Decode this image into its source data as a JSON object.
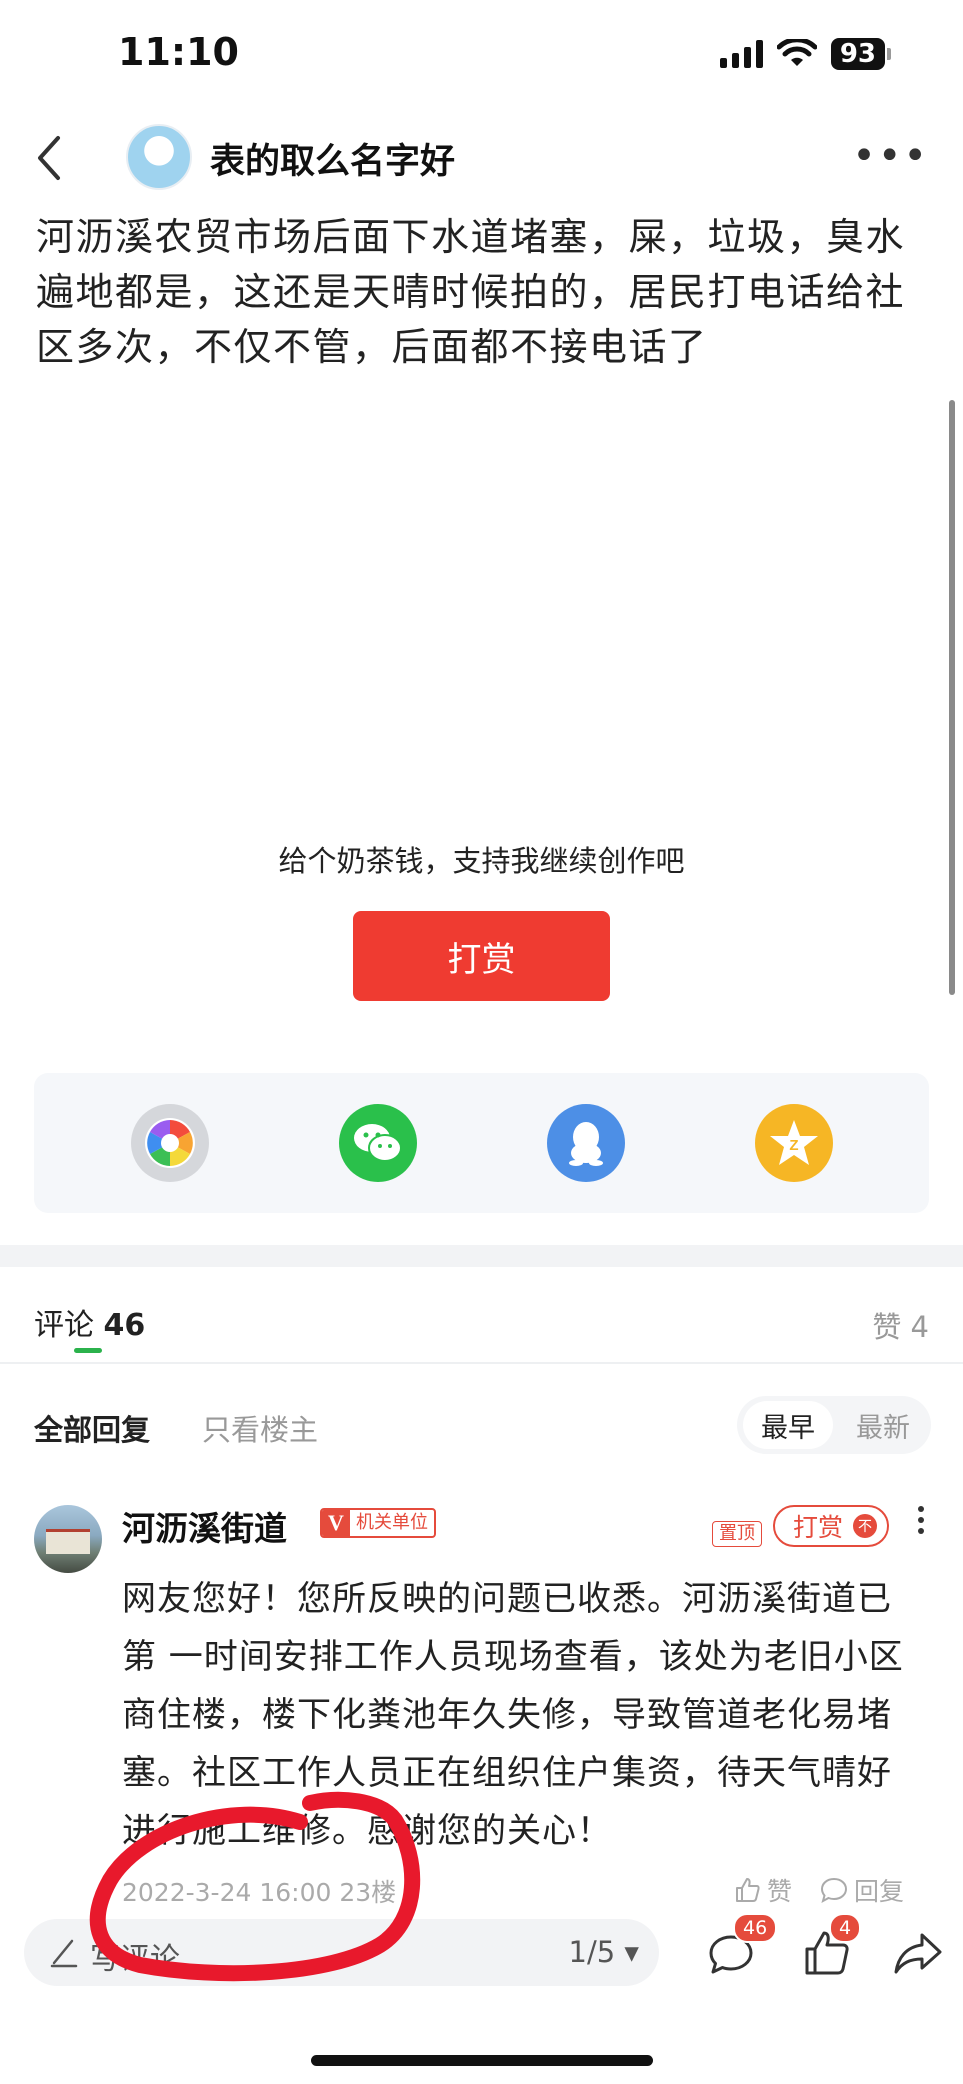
{
  "status": {
    "time": "11:10",
    "battery": "93"
  },
  "header": {
    "title": "表的取么名字好"
  },
  "post": {
    "text": "河沥溪农贸市场后面下水道堵塞，屎，垃圾，臭水遍地都是，这还是天晴时候拍的，居民打电话给社区多次，不仅不管，后面都不接电话了",
    "tip": "给个奶茶钱，支持我继续创作吧",
    "reward_label": "打赏"
  },
  "share": {
    "icons": [
      "moments-icon",
      "wechat-icon",
      "qq-icon",
      "qzone-icon"
    ]
  },
  "comments": {
    "tab_label": "评论",
    "count": "46",
    "likes": "赞 4",
    "filter_all": "全部回复",
    "filter_op": "只看楼主",
    "sort_earliest": "最早",
    "sort_latest": "最新",
    "items": [
      {
        "author": "河沥溪街道",
        "badge_v": "V",
        "badge_text": "机关单位",
        "pin": "置顶",
        "reward": "打赏",
        "text": "网友您好！您所反映的问题已收悉。河沥溪街道已第 一时间安排工作人员现场查看，该处为老旧小区商住楼，楼下化粪池年久失修，导致管道老化易堵塞。社区工作人员正在组织住户集资，待天气晴好进行施工维修。感谢您的关心！",
        "meta": "2022-3-24 16:00 23楼",
        "like_label": "赞",
        "reply_label": "回复"
      }
    ]
  },
  "bottom_bar": {
    "placeholder": "写评论",
    "page": "1/5",
    "comment_count": "46",
    "like_count": "4"
  },
  "colors": {
    "accent_red": "#ef3b31",
    "green": "#2bb24c",
    "annotation_red": "#e8192c"
  }
}
